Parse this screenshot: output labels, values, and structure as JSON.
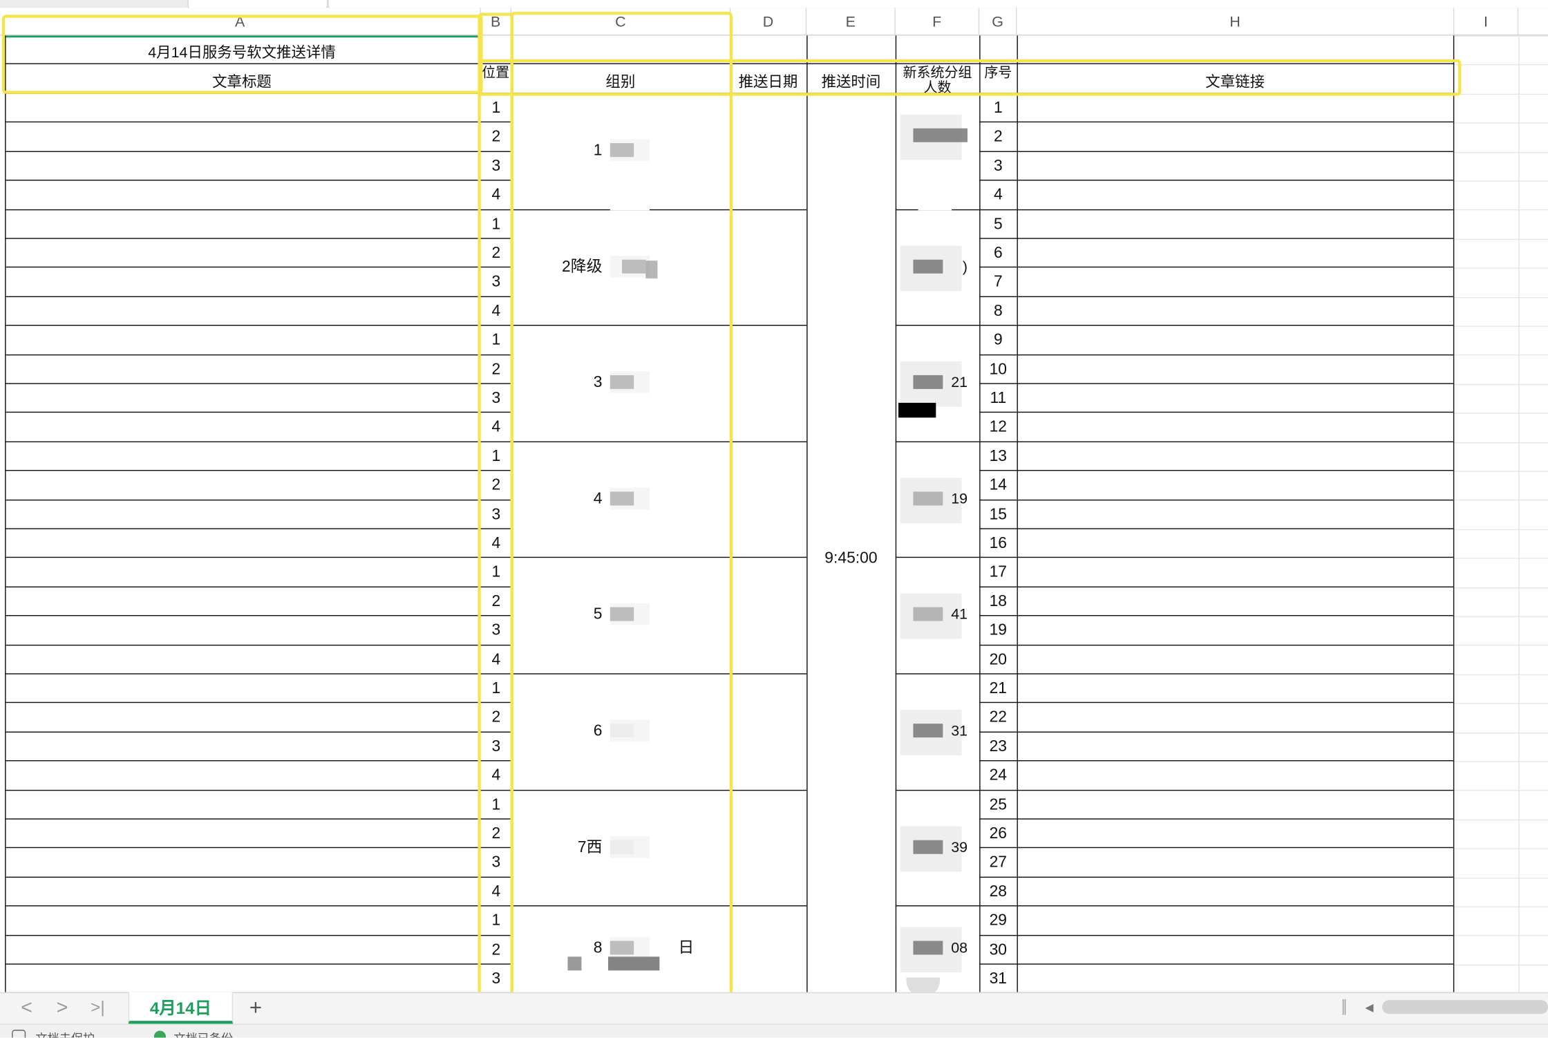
{
  "sheet": {
    "columns": [
      "A",
      "B",
      "C",
      "D",
      "E",
      "F",
      "G",
      "H",
      "I"
    ],
    "title_cell": "4月14日服务号软文推送详情",
    "headers": {
      "article_title": "文章标题",
      "position": "位置",
      "group": "组别",
      "push_date": "推送日期",
      "push_time": "推送时间",
      "new_system_count": "新系统分组人数",
      "serial": "序号",
      "article_link": "文章链接"
    },
    "positions": [
      "1",
      "2",
      "3",
      "4",
      "1",
      "2",
      "3",
      "4",
      "1",
      "2",
      "3",
      "4",
      "1",
      "2",
      "3",
      "4",
      "1",
      "2",
      "3",
      "4",
      "1",
      "2",
      "3",
      "4",
      "1",
      "2",
      "3",
      "4",
      "1",
      "2",
      "3"
    ],
    "serials": [
      "1",
      "2",
      "3",
      "4",
      "5",
      "6",
      "7",
      "8",
      "9",
      "10",
      "11",
      "12",
      "13",
      "14",
      "15",
      "16",
      "17",
      "18",
      "19",
      "20",
      "21",
      "22",
      "23",
      "24",
      "25",
      "26",
      "27",
      "28",
      "29",
      "30",
      "31"
    ],
    "groups": [
      "1",
      "2降级",
      "3",
      "4",
      "5",
      "6",
      "7西",
      "8"
    ],
    "group_suffixes": [
      "",
      "",
      "",
      "",
      "",
      "",
      "",
      "日"
    ],
    "f_fragments": [
      "",
      ")",
      "21",
      "19",
      "41",
      "31",
      "39",
      "08"
    ],
    "push_time": "9:45:00"
  },
  "bottom": {
    "sheet_tab": "4月14日",
    "add_sheet": "+",
    "nav_prev": "<",
    "nav_next": ">",
    "nav_last": ">|",
    "status_left": "文档未保护",
    "status_right": "文档已备份"
  },
  "colors": {
    "highlight": "#f5e44a",
    "accent": "#1aa05a",
    "grid_border": "#111111"
  }
}
